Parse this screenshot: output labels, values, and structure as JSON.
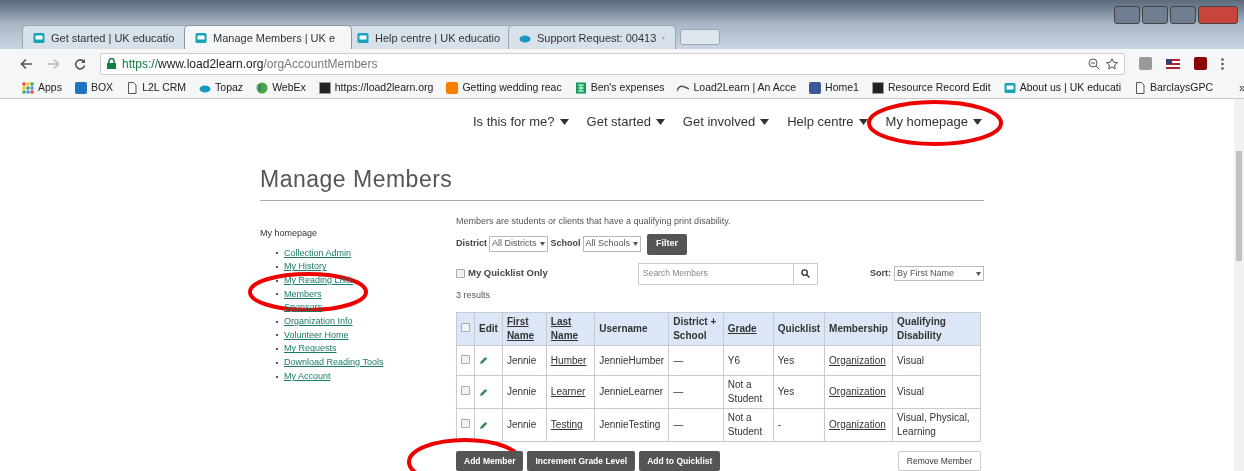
{
  "browser": {
    "tabs": [
      {
        "title": "Get started | UK educatio",
        "selected": false,
        "kind": "site"
      },
      {
        "title": "Manage Members | UK e",
        "selected": true,
        "kind": "site"
      },
      {
        "title": "Help centre | UK educatio",
        "selected": false,
        "kind": "site"
      },
      {
        "title": "Support Request: 00413",
        "selected": false,
        "kind": "cloud"
      }
    ],
    "url": {
      "scheme": "https://",
      "host": "www.load2learn.org",
      "path": "/orgAccountMembers"
    },
    "bookmarks": [
      {
        "label": "Apps",
        "kind": "grid"
      },
      {
        "label": "BOX",
        "kind": "box"
      },
      {
        "label": "L2L CRM",
        "kind": "page"
      },
      {
        "label": "Topaz",
        "kind": "cloud"
      },
      {
        "label": "WebEx",
        "kind": "globe"
      },
      {
        "label": "https://load2learn.org",
        "kind": "square"
      },
      {
        "label": "Getting wedding reac",
        "kind": "blog"
      },
      {
        "label": "Ben's expenses",
        "kind": "sheet"
      },
      {
        "label": "Load2Learn | An Acce",
        "kind": "wave"
      },
      {
        "label": "Home1",
        "kind": "facebook"
      },
      {
        "label": "Resource Record Edit",
        "kind": "square"
      },
      {
        "label": "About us | UK educati",
        "kind": "site"
      },
      {
        "label": "BarclaysGPC",
        "kind": "page"
      }
    ],
    "more": "»"
  },
  "nav": [
    {
      "label": "Is this for me?"
    },
    {
      "label": "Get started"
    },
    {
      "label": "Get involved"
    },
    {
      "label": "Help centre"
    },
    {
      "label": "My homepage"
    }
  ],
  "title": "Manage Members",
  "sidebar": {
    "heading": "My homepage",
    "links": [
      "Collection Admin",
      "My History",
      "My Reading Lists",
      "Members",
      "Sponsors",
      "Organization Info",
      "Volunteer Home",
      "My Requests",
      "Download Reading Tools",
      "My Account"
    ]
  },
  "intro": "Members are students or clients that have a qualifying print disability.",
  "filters": {
    "district_label": "District",
    "district_value": "All Districts",
    "school_label": "School",
    "school_value": "All Schools",
    "button": "Filter"
  },
  "quicklist_only": {
    "label": "My Quicklist Only",
    "checked": false
  },
  "search": {
    "placeholder": "Search Members"
  },
  "sort": {
    "label": "Sort:",
    "value": "By First Name"
  },
  "results": "3 results",
  "table": {
    "header_checked": false,
    "columns": [
      {
        "label": "Edit",
        "sortable": false
      },
      {
        "label": "First Name",
        "sortable": true
      },
      {
        "label": "Last Name",
        "sortable": true
      },
      {
        "label": "Username",
        "sortable": false
      },
      {
        "label": "District + School",
        "sortable": false
      },
      {
        "label": "Grade",
        "sortable": true
      },
      {
        "label": "Quicklist",
        "sortable": false
      },
      {
        "label": "Membership",
        "sortable": false
      },
      {
        "label": "Qualifying Disability",
        "sortable": false
      }
    ],
    "rows": [
      {
        "checked": false,
        "first": "Jennie",
        "last": "Humber",
        "username": "JennieHumber",
        "district": "—",
        "grade": "Y6",
        "quicklist": "Yes",
        "membership": "Organization",
        "disability": "Visual"
      },
      {
        "checked": false,
        "first": "Jennie",
        "last": "Learner",
        "username": "JennieLearner",
        "district": "—",
        "grade": "Not a Student",
        "quicklist": "Yes",
        "membership": "Organization",
        "disability": "Visual"
      },
      {
        "checked": false,
        "first": "Jennie",
        "last": "Testing",
        "username": "JennieTesting",
        "district": "—",
        "grade": "Not a Student",
        "quicklist": "-",
        "membership": "Organization",
        "disability": "Visual, Physical, Learning"
      }
    ]
  },
  "actions": [
    "Add Member",
    "Increment Grade Level",
    "Add to Quicklist"
  ],
  "remove": "Remove Member"
}
